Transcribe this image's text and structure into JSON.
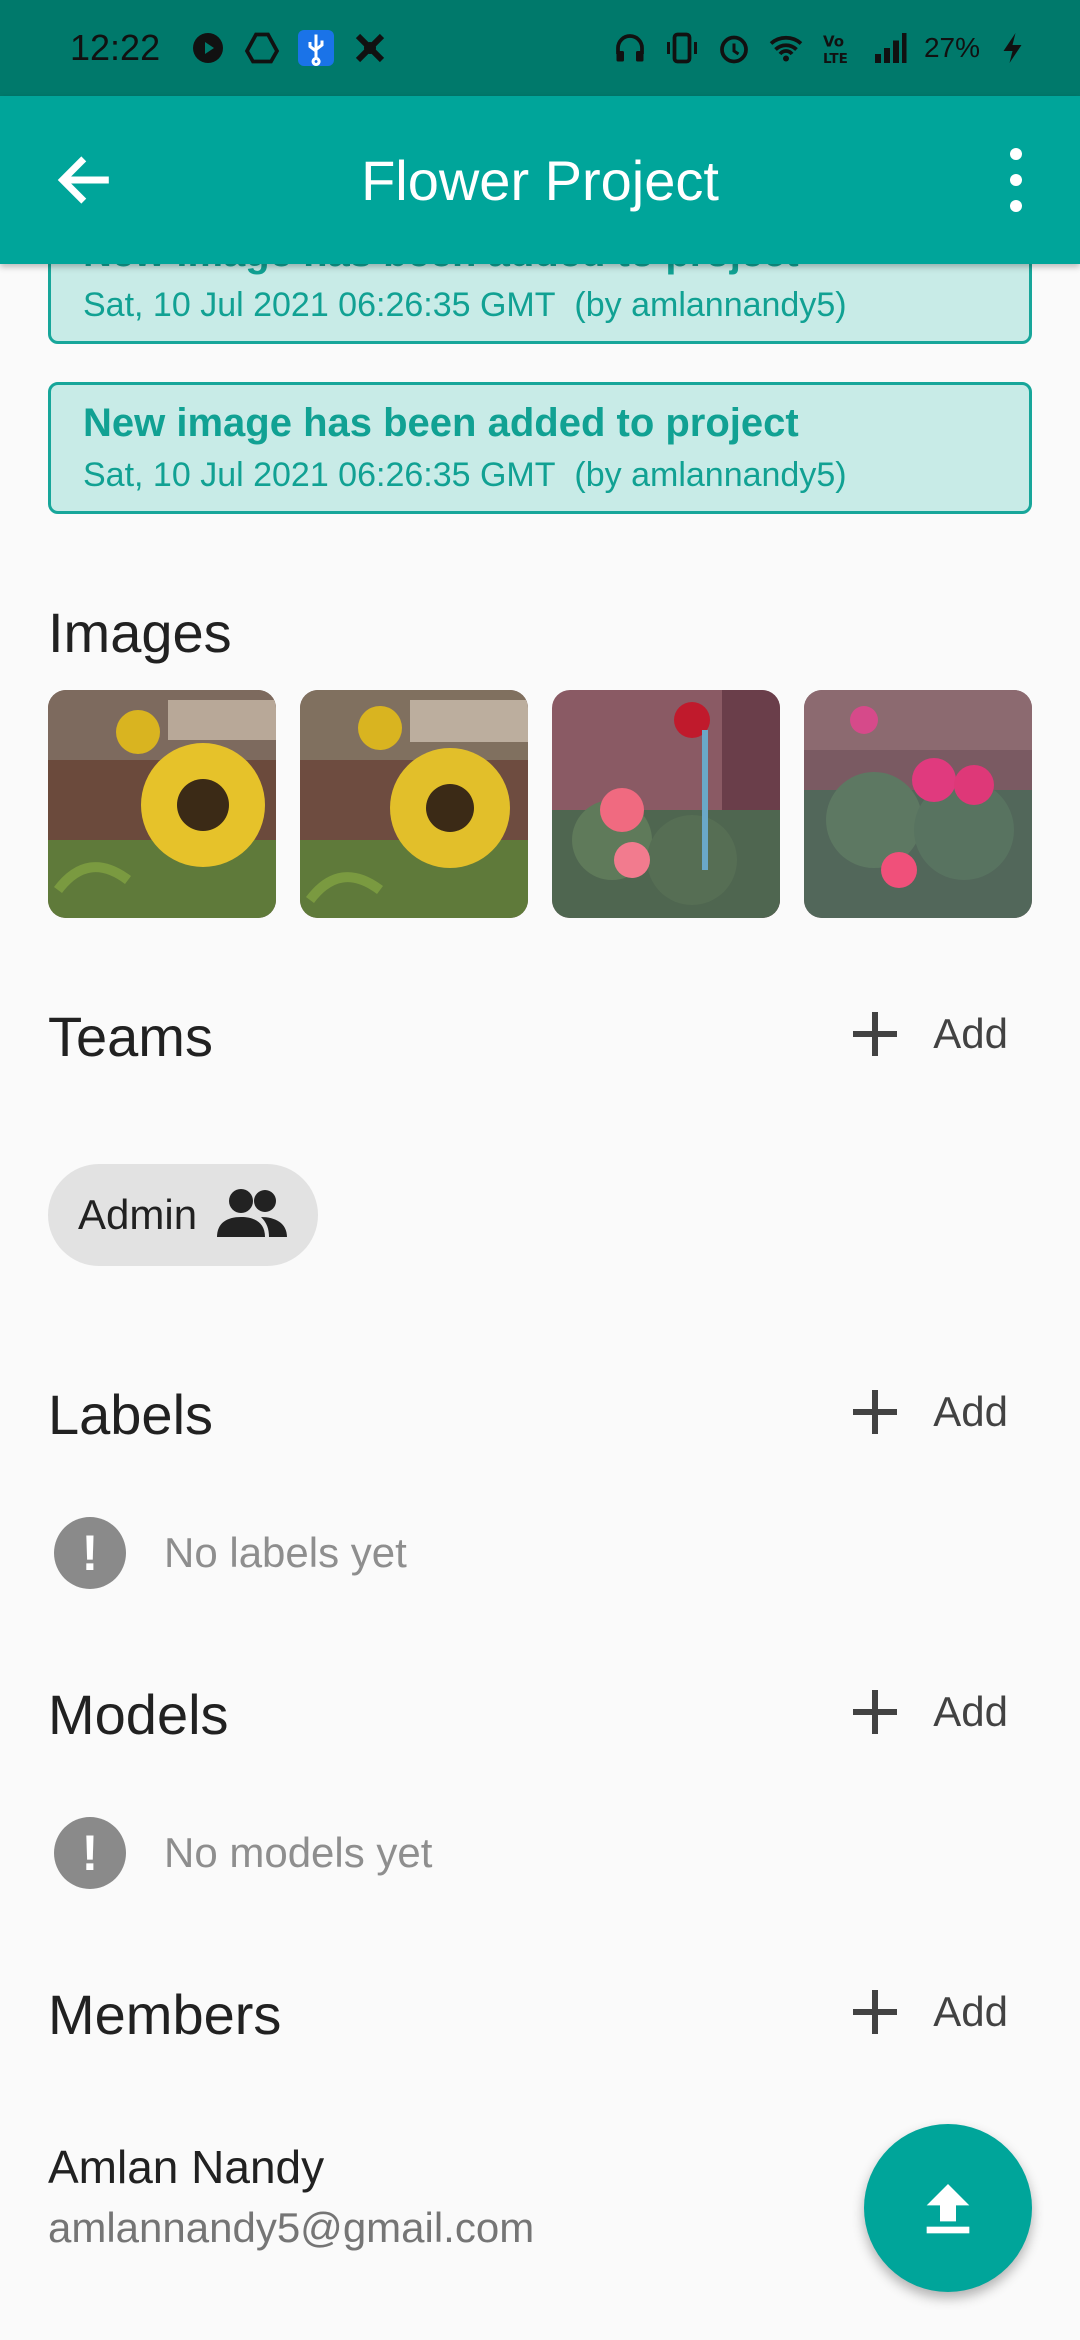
{
  "status_bar": {
    "time": "12:22",
    "battery": "27%"
  },
  "app_bar": {
    "title": "Flower Project"
  },
  "notifications": [
    {
      "message": "New image has been added to project",
      "timestamp": "Sat, 10 Jul 2021 06:26:35 GMT",
      "by": "(by amlannandy5)"
    },
    {
      "message": "New image has been added to project",
      "timestamp": "Sat, 10 Jul 2021 06:26:35 GMT",
      "by": "(by amlannandy5)"
    }
  ],
  "images": {
    "title": "Images",
    "thumbnails": [
      "sunflower",
      "sunflower",
      "dahlia",
      "dahlia"
    ]
  },
  "teams": {
    "title": "Teams",
    "add_label": "Add",
    "chips": [
      {
        "label": "Admin",
        "icon": "people-icon"
      }
    ]
  },
  "labels": {
    "title": "Labels",
    "add_label": "Add",
    "empty_text": "No labels yet"
  },
  "models": {
    "title": "Models",
    "add_label": "Add",
    "empty_text": "No models yet"
  },
  "members": {
    "title": "Members",
    "add_label": "Add",
    "list": [
      {
        "name": "Amlan Nandy",
        "email": "amlannandy5@gmail.com"
      }
    ]
  },
  "fab": {
    "icon": "upload-icon"
  },
  "colors": {
    "primary": "#00a59a",
    "primary_dark": "#00796b",
    "notification_bg": "#c8ebe7",
    "notification_text": "#11a193"
  }
}
